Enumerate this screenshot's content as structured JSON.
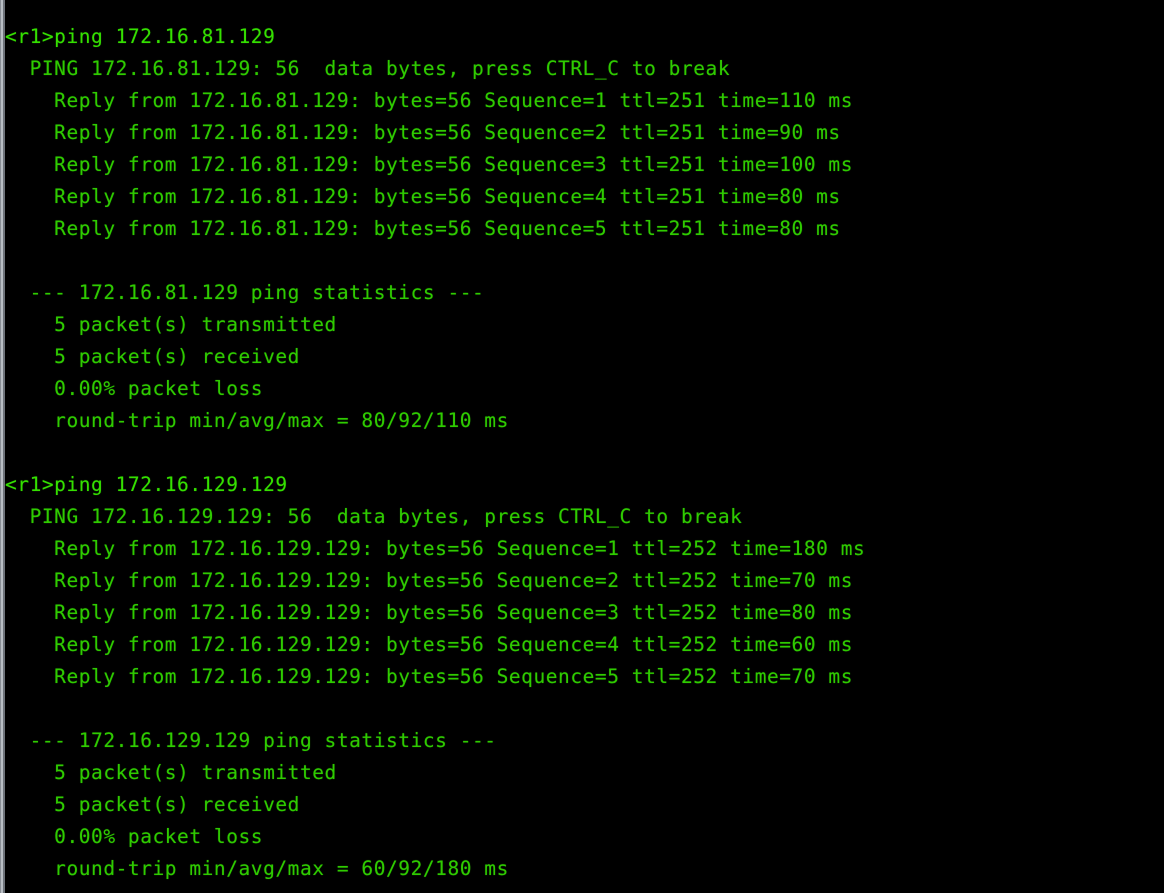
{
  "window": {
    "title": "Terminal",
    "background_color": "#000000",
    "text_color": "#2fcb00",
    "prompt_color": "#35e000",
    "gutter_color": "#b9bec4"
  },
  "session": {
    "prompt": "<r1>",
    "device_name": "r1",
    "commands": [
      "ping 172.16.81.129",
      "ping 172.16.129.129"
    ]
  },
  "ping_runs": [
    {
      "command_line": "<r1>ping 172.16.81.129",
      "target": "172.16.81.129",
      "header": "  PING 172.16.81.129: 56  data bytes, press CTRL_C to break",
      "data_bytes": "56",
      "break_hint": "press CTRL_C to break",
      "replies": [
        "    Reply from 172.16.81.129: bytes=56 Sequence=1 ttl=251 time=110 ms",
        "    Reply from 172.16.81.129: bytes=56 Sequence=2 ttl=251 time=90 ms",
        "    Reply from 172.16.81.129: bytes=56 Sequence=3 ttl=251 time=100 ms",
        "    Reply from 172.16.81.129: bytes=56 Sequence=4 ttl=251 time=80 ms",
        "    Reply from 172.16.81.129: bytes=56 Sequence=5 ttl=251 time=80 ms"
      ],
      "reply_values": [
        {
          "from": "172.16.81.129",
          "bytes": "56",
          "sequence": "1",
          "ttl": "251",
          "time": "110 ms"
        },
        {
          "from": "172.16.81.129",
          "bytes": "56",
          "sequence": "2",
          "ttl": "251",
          "time": "90 ms"
        },
        {
          "from": "172.16.81.129",
          "bytes": "56",
          "sequence": "3",
          "ttl": "251",
          "time": "100 ms"
        },
        {
          "from": "172.16.81.129",
          "bytes": "56",
          "sequence": "4",
          "ttl": "251",
          "time": "80 ms"
        },
        {
          "from": "172.16.81.129",
          "bytes": "56",
          "sequence": "5",
          "ttl": "251",
          "time": "80 ms"
        }
      ],
      "stats_header": "  --- 172.16.81.129 ping statistics ---",
      "stats_lines": [
        "    5 packet(s) transmitted",
        "    5 packet(s) received",
        "    0.00% packet loss",
        "    round-trip min/avg/max = 80/92/110 ms"
      ],
      "stats_values": {
        "transmitted": "5",
        "received": "5",
        "packet_loss": "0.00%",
        "min": "80",
        "avg": "92",
        "max": "110",
        "unit": "ms"
      }
    },
    {
      "command_line": "<r1>ping 172.16.129.129",
      "target": "172.16.129.129",
      "header": "  PING 172.16.129.129: 56  data bytes, press CTRL_C to break",
      "data_bytes": "56",
      "break_hint": "press CTRL_C to break",
      "replies": [
        "    Reply from 172.16.129.129: bytes=56 Sequence=1 ttl=252 time=180 ms",
        "    Reply from 172.16.129.129: bytes=56 Sequence=2 ttl=252 time=70 ms",
        "    Reply from 172.16.129.129: bytes=56 Sequence=3 ttl=252 time=80 ms",
        "    Reply from 172.16.129.129: bytes=56 Sequence=4 ttl=252 time=60 ms",
        "    Reply from 172.16.129.129: bytes=56 Sequence=5 ttl=252 time=70 ms"
      ],
      "reply_values": [
        {
          "from": "172.16.129.129",
          "bytes": "56",
          "sequence": "1",
          "ttl": "252",
          "time": "180 ms"
        },
        {
          "from": "172.16.129.129",
          "bytes": "56",
          "sequence": "2",
          "ttl": "252",
          "time": "70 ms"
        },
        {
          "from": "172.16.129.129",
          "bytes": "56",
          "sequence": "3",
          "ttl": "252",
          "time": "80 ms"
        },
        {
          "from": "172.16.129.129",
          "bytes": "56",
          "sequence": "4",
          "ttl": "252",
          "time": "60 ms"
        },
        {
          "from": "172.16.129.129",
          "bytes": "56",
          "sequence": "5",
          "ttl": "252",
          "time": "70 ms"
        }
      ],
      "stats_header": "  --- 172.16.129.129 ping statistics ---",
      "stats_lines": [
        "    5 packet(s) transmitted",
        "    5 packet(s) received",
        "    0.00% packet loss",
        "    round-trip min/avg/max = 60/92/180 ms"
      ],
      "stats_values": {
        "transmitted": "5",
        "received": "5",
        "packet_loss": "0.00%",
        "min": "60",
        "avg": "92",
        "max": "180",
        "unit": "ms"
      }
    }
  ],
  "lines": [
    "<r1>ping 172.16.81.129",
    "  PING 172.16.81.129: 56  data bytes, press CTRL_C to break",
    "    Reply from 172.16.81.129: bytes=56 Sequence=1 ttl=251 time=110 ms",
    "    Reply from 172.16.81.129: bytes=56 Sequence=2 ttl=251 time=90 ms",
    "    Reply from 172.16.81.129: bytes=56 Sequence=3 ttl=251 time=100 ms",
    "    Reply from 172.16.81.129: bytes=56 Sequence=4 ttl=251 time=80 ms",
    "    Reply from 172.16.81.129: bytes=56 Sequence=5 ttl=251 time=80 ms",
    "",
    "  --- 172.16.81.129 ping statistics ---",
    "    5 packet(s) transmitted",
    "    5 packet(s) received",
    "    0.00% packet loss",
    "    round-trip min/avg/max = 80/92/110 ms",
    "",
    "<r1>ping 172.16.129.129",
    "  PING 172.16.129.129: 56  data bytes, press CTRL_C to break",
    "    Reply from 172.16.129.129: bytes=56 Sequence=1 ttl=252 time=180 ms",
    "    Reply from 172.16.129.129: bytes=56 Sequence=2 ttl=252 time=70 ms",
    "    Reply from 172.16.129.129: bytes=56 Sequence=3 ttl=252 time=80 ms",
    "    Reply from 172.16.129.129: bytes=56 Sequence=4 ttl=252 time=60 ms",
    "    Reply from 172.16.129.129: bytes=56 Sequence=5 ttl=252 time=70 ms",
    "",
    "  --- 172.16.129.129 ping statistics ---",
    "    5 packet(s) transmitted",
    "    5 packet(s) received",
    "    0.00% packet loss",
    "    round-trip min/avg/max = 60/92/180 ms"
  ],
  "line_kinds": [
    "prompt",
    "header",
    "reply",
    "reply",
    "reply",
    "reply",
    "reply",
    "blank",
    "stats-header",
    "stats",
    "stats",
    "stats",
    "stats",
    "blank",
    "prompt",
    "header",
    "reply",
    "reply",
    "reply",
    "reply",
    "reply",
    "blank",
    "stats-header",
    "stats",
    "stats",
    "stats",
    "stats"
  ]
}
